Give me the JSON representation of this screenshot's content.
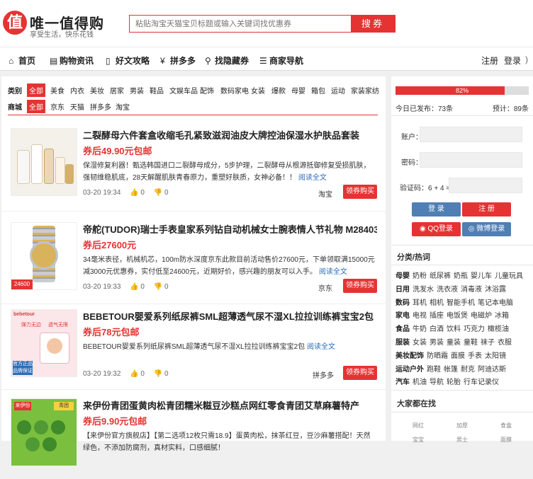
{
  "header": {
    "logo_char": "值",
    "title": "唯一值得购",
    "slogan": "享受生活，快乐花钱",
    "search_placeholder": "粘贴淘宝天猫宝贝标题或输入关键词找优惠券",
    "search_button": "搜券"
  },
  "nav": {
    "items": [
      {
        "icon": "home-icon",
        "label": "首页"
      },
      {
        "icon": "news-icon",
        "label": "购物资讯"
      },
      {
        "icon": "article-icon",
        "label": "好文攻略"
      },
      {
        "icon": "yen-icon",
        "label": "拼多多"
      },
      {
        "icon": "search-icon",
        "label": "找隐藏券"
      },
      {
        "icon": "menu-icon",
        "label": "商家导航"
      }
    ],
    "register": "注册",
    "login": "登录",
    "rss_icon": "rss-icon"
  },
  "filters": {
    "category_label": "类别",
    "categories": [
      "全部",
      "美食",
      "内衣",
      "美妆",
      "居家",
      "男装",
      "鞋品",
      "文娱车品",
      "配饰",
      "数码家电",
      "女装",
      "爆款",
      "母婴",
      "箱包",
      "运动",
      "家装家纺"
    ],
    "mall_label": "商城",
    "malls": [
      "全部",
      "京东",
      "天猫",
      "拼多多",
      "淘宝"
    ]
  },
  "items": [
    {
      "title": "二裂酵母六件套盒收缩毛孔紧致滋润油皮大牌控油保湿水护肤品套装",
      "price": "券后49.90元包邮",
      "desc": "保湿修复利器！甄选韩国进口二裂酵母成分，5步护理，二裂酵母从根源抵御修复受损肌肤，强韧维稳肌底，28天解醒肌肤青春原力，重塑好肤质，女神必备！！",
      "more": "阅读全文",
      "time": "03-20 19:34",
      "likes": "0",
      "dislikes": "0",
      "shop": "淘宝",
      "buy": "领券购买"
    },
    {
      "title": "帝舵(TUDOR)瑞士手表皇家系列钻自动机械女士腕表情人节礼物 M28403-...",
      "price": "券后27600元",
      "desc": "34毫米表径，机械机芯，100m防水深度京东此款目前活动售价27600元，下单领取满15000元减3000元优惠券，实付低至24600元，近期好价，感兴趣的朋友可以入手。",
      "more": "阅读全文",
      "time": "03-20 19:33",
      "likes": "0",
      "dislikes": "0",
      "shop": "京东",
      "buy": "领券购买"
    },
    {
      "title": "BEBETOUR婴爱系列纸尿裤SML超薄透气尿不湿XL拉拉训练裤宝宝2包",
      "price": "券后78元包邮",
      "desc": "BEBETOUR婴爱系列纸尿裤SML超薄透气尿不湿XL拉拉训练裤宝宝2包",
      "more": "阅读全文",
      "time": "03-20 19:32",
      "likes": "0",
      "dislikes": "0",
      "shop": "拼多多",
      "buy": "领券购买"
    },
    {
      "title": "来伊份青团蛋黄肉松青团糯米糍豆沙糕点网红零食青团艾草麻薯特产",
      "price": "券后9.90元包邮",
      "desc": "【来伊份官方旗舰店】【第二选项12枚只需18.9】蛋黄肉松，抹茶红豆，豆沙麻薯搭配！天然绿色，不添加防腐剂，真材实料，口感细腻！",
      "more": "",
      "time": "",
      "likes": "",
      "dislikes": "",
      "shop": "",
      "buy": ""
    }
  ],
  "thumb_text": {
    "item2_tag": "24600",
    "item3_brand": "bebetour",
    "item3_line1": "弹力无边",
    "item3_line2": "透气无限",
    "item3_badge1": "官方正品",
    "item3_badge2": "品牌保证",
    "item4_badge": "来伊份",
    "item4_badge2": "青团"
  },
  "sidebar": {
    "progress_percent": 82,
    "progress_label": "82%",
    "published": "今日已发布：73条",
    "expected": "预计：89条",
    "account_label": "账户：",
    "password_label": "密码：",
    "captcha_label": "验证码：6 + 4 =",
    "login_btn": "登 录",
    "register_btn": "注 册",
    "qq_btn": "QQ登录",
    "weibo_btn": "微博登录",
    "cat_title": "分类/热词",
    "cats": [
      {
        "name": "母婴",
        "words": [
          "奶粉",
          "纸尿裤",
          "奶瓶",
          "婴儿车",
          "儿童玩具"
        ]
      },
      {
        "name": "日用",
        "words": [
          "洗发水",
          "洗衣液",
          "消毒液",
          "沐浴露"
        ]
      },
      {
        "name": "数码",
        "words": [
          "耳机",
          "相机",
          "智能手机",
          "笔记本电脑"
        ]
      },
      {
        "name": "家电",
        "words": [
          "电视",
          "插座",
          "电饭煲",
          "电磁炉",
          "冰箱"
        ]
      },
      {
        "name": "食品",
        "words": [
          "牛奶",
          "白酒",
          "饮料",
          "巧克力",
          "橄榄油"
        ]
      },
      {
        "name": "服装",
        "words": [
          "女装",
          "男装",
          "童装",
          "童鞋",
          "袜子",
          "衣服"
        ]
      },
      {
        "name": "美妆配饰",
        "words": [
          "防晒霜",
          "面膜",
          "手表",
          "太阳镜"
        ]
      },
      {
        "name": "运动户外",
        "words": [
          "跑鞋",
          "帐篷",
          "耐克",
          "阿迪达斯"
        ]
      },
      {
        "name": "汽车",
        "words": [
          "机油",
          "导航",
          "轮胎",
          "行车记录仪"
        ]
      }
    ],
    "hot_title": "大家都在找",
    "hot_tags": [
      "网红",
      "加厚",
      "食盒",
      "宝宝",
      "男士",
      "面膜"
    ]
  },
  "colors": {
    "accent": "#e53333",
    "login_btn": "#4f7fb3",
    "qq_btn": "#e53333",
    "weibo_btn": "#4f7fb3"
  }
}
